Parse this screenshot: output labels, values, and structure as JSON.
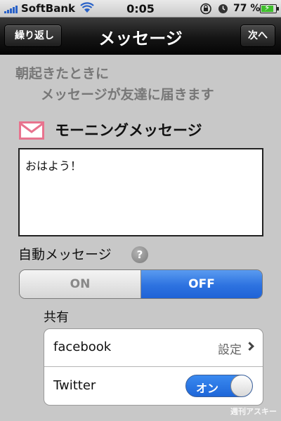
{
  "status_bar": {
    "carrier": "SoftBank",
    "time": "0:05",
    "battery_percent": "77 %",
    "battery_level": 0.77,
    "icons": [
      "signal-icon",
      "wifi-icon",
      "rotation-lock-icon",
      "alarm-icon",
      "battery-charging-icon"
    ]
  },
  "nav": {
    "back_label": "繰り返し",
    "title": "メッセージ",
    "next_label": "次へ"
  },
  "intro": {
    "line1": "朝起きたときに",
    "line2": "メッセージが友達に届きます"
  },
  "morning_message": {
    "icon": "mail-icon",
    "title": "モーニングメッセージ",
    "text": "おはよう！"
  },
  "auto_message": {
    "label": "自動メッセージ",
    "help_glyph": "?",
    "on_label": "ON",
    "off_label": "OFF",
    "selected": "OFF"
  },
  "share": {
    "label": "共有",
    "facebook": {
      "label": "facebook",
      "value": "設定"
    },
    "twitter": {
      "label": "Twitter",
      "toggle_label": "オン",
      "enabled": true
    }
  },
  "watermark": "週刊アスキー",
  "colors": {
    "background": "#c8c8c8",
    "accent_blue": "#2d72e0",
    "mail_icon_pink": "#e8738e"
  }
}
